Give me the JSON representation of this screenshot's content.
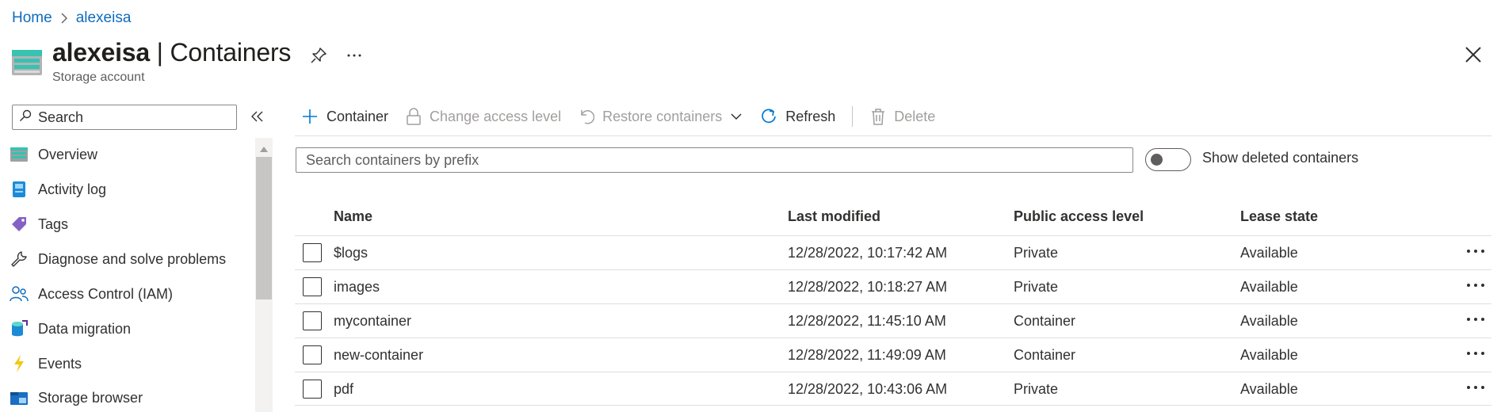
{
  "breadcrumb": {
    "home": "Home",
    "current": "alexeisa"
  },
  "header": {
    "account_name": "alexeisa",
    "separator": " | ",
    "section": "Containers",
    "subtitle": "Storage account"
  },
  "sidebar": {
    "search_placeholder": "Search",
    "items": [
      {
        "label": "Overview",
        "icon": "overview-icon"
      },
      {
        "label": "Activity log",
        "icon": "activity-log-icon"
      },
      {
        "label": "Tags",
        "icon": "tag-icon"
      },
      {
        "label": "Diagnose and solve problems",
        "icon": "wrench-icon"
      },
      {
        "label": "Access Control (IAM)",
        "icon": "people-icon"
      },
      {
        "label": "Data migration",
        "icon": "data-migration-icon"
      },
      {
        "label": "Events",
        "icon": "lightning-icon"
      },
      {
        "label": "Storage browser",
        "icon": "storage-browser-icon"
      }
    ]
  },
  "toolbar": {
    "add_container": "Container",
    "change_access_level": "Change access level",
    "restore_containers": "Restore containers",
    "refresh": "Refresh",
    "delete": "Delete"
  },
  "filter": {
    "search_placeholder": "Search containers by prefix",
    "show_deleted_label": "Show deleted containers",
    "show_deleted_on": false
  },
  "table": {
    "columns": [
      "Name",
      "Last modified",
      "Public access level",
      "Lease state"
    ],
    "rows": [
      {
        "name": "$logs",
        "last_modified": "12/28/2022, 10:17:42 AM",
        "access": "Private",
        "lease": "Available"
      },
      {
        "name": "images",
        "last_modified": "12/28/2022, 10:18:27 AM",
        "access": "Private",
        "lease": "Available"
      },
      {
        "name": "mycontainer",
        "last_modified": "12/28/2022, 11:45:10 AM",
        "access": "Container",
        "lease": "Available"
      },
      {
        "name": "new-container",
        "last_modified": "12/28/2022, 11:49:09 AM",
        "access": "Container",
        "lease": "Available"
      },
      {
        "name": "pdf",
        "last_modified": "12/28/2022, 10:43:06 AM",
        "access": "Private",
        "lease": "Available"
      }
    ]
  },
  "colors": {
    "link": "#0f6cbd",
    "accent": "#0078d4",
    "text": "#323130",
    "disabled": "#a19f9d",
    "storage_icon": "#37c2b1"
  }
}
